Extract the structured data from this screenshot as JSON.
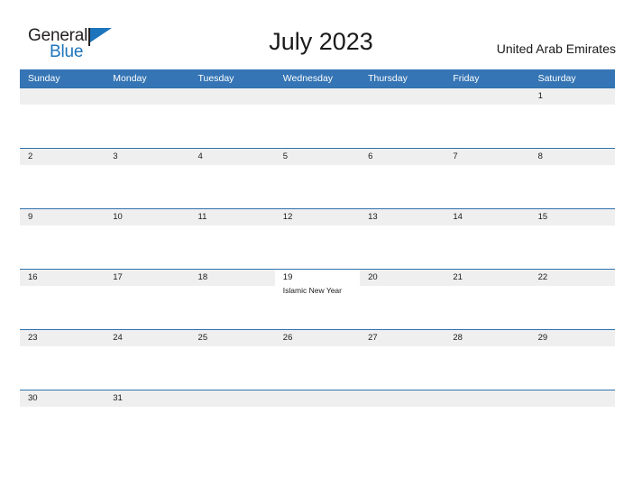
{
  "brand": {
    "name_top": "General",
    "name_bottom": "Blue",
    "color_dark": "#231f20",
    "color_blue": "#1c75bc"
  },
  "header": {
    "title": "July 2023",
    "country": "United Arab Emirates"
  },
  "calendar": {
    "header_bg": "#3575b5",
    "row_line_color": "#2e72ad",
    "cell_band_color": "#efefef",
    "weekdays": [
      "Sunday",
      "Monday",
      "Tuesday",
      "Wednesday",
      "Thursday",
      "Friday",
      "Saturday"
    ],
    "weeks": [
      [
        {
          "day": ""
        },
        {
          "day": ""
        },
        {
          "day": ""
        },
        {
          "day": ""
        },
        {
          "day": ""
        },
        {
          "day": ""
        },
        {
          "day": "1"
        }
      ],
      [
        {
          "day": "2"
        },
        {
          "day": "3"
        },
        {
          "day": "4"
        },
        {
          "day": "5"
        },
        {
          "day": "6"
        },
        {
          "day": "7"
        },
        {
          "day": "8"
        }
      ],
      [
        {
          "day": "9"
        },
        {
          "day": "10"
        },
        {
          "day": "11"
        },
        {
          "day": "12"
        },
        {
          "day": "13"
        },
        {
          "day": "14"
        },
        {
          "day": "15"
        }
      ],
      [
        {
          "day": "16"
        },
        {
          "day": "17"
        },
        {
          "day": "18"
        },
        {
          "day": "19",
          "event": "Islamic New Year"
        },
        {
          "day": "20"
        },
        {
          "day": "21"
        },
        {
          "day": "22"
        }
      ],
      [
        {
          "day": "23"
        },
        {
          "day": "24"
        },
        {
          "day": "25"
        },
        {
          "day": "26"
        },
        {
          "day": "27"
        },
        {
          "day": "28"
        },
        {
          "day": "29"
        }
      ],
      [
        {
          "day": "30"
        },
        {
          "day": "31"
        },
        {
          "day": ""
        },
        {
          "day": ""
        },
        {
          "day": ""
        },
        {
          "day": ""
        },
        {
          "day": ""
        }
      ]
    ]
  }
}
